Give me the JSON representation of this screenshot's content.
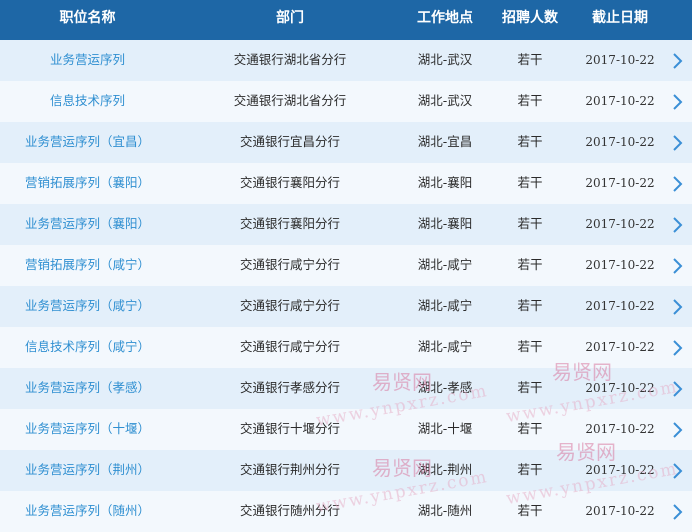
{
  "table": {
    "headers": {
      "title": "职位名称",
      "dept": "部门",
      "location": "工作地点",
      "count": "招聘人数",
      "deadline": "截止日期"
    },
    "rows": [
      {
        "title": "业务营运序列",
        "dept": "交通银行湖北省分行",
        "location": "湖北-武汉",
        "count": "若干",
        "deadline": "2017-10-22"
      },
      {
        "title": "信息技术序列",
        "dept": "交通银行湖北省分行",
        "location": "湖北-武汉",
        "count": "若干",
        "deadline": "2017-10-22"
      },
      {
        "title": "业务营运序列（宜昌）",
        "dept": "交通银行宜昌分行",
        "location": "湖北-宜昌",
        "count": "若干",
        "deadline": "2017-10-22"
      },
      {
        "title": "营销拓展序列（襄阳）",
        "dept": "交通银行襄阳分行",
        "location": "湖北-襄阳",
        "count": "若干",
        "deadline": "2017-10-22"
      },
      {
        "title": "业务营运序列（襄阳）",
        "dept": "交通银行襄阳分行",
        "location": "湖北-襄阳",
        "count": "若干",
        "deadline": "2017-10-22"
      },
      {
        "title": "营销拓展序列（咸宁）",
        "dept": "交通银行咸宁分行",
        "location": "湖北-咸宁",
        "count": "若干",
        "deadline": "2017-10-22"
      },
      {
        "title": "业务营运序列（咸宁）",
        "dept": "交通银行咸宁分行",
        "location": "湖北-咸宁",
        "count": "若干",
        "deadline": "2017-10-22"
      },
      {
        "title": "信息技术序列（咸宁）",
        "dept": "交通银行咸宁分行",
        "location": "湖北-咸宁",
        "count": "若干",
        "deadline": "2017-10-22"
      },
      {
        "title": "业务营运序列（孝感）",
        "dept": "交通银行孝感分行",
        "location": "湖北-孝感",
        "count": "若干",
        "deadline": "2017-10-22"
      },
      {
        "title": "业务营运序列（十堰）",
        "dept": "交通银行十堰分行",
        "location": "湖北-十堰",
        "count": "若干",
        "deadline": "2017-10-22"
      },
      {
        "title": "业务营运序列（荆州）",
        "dept": "交通银行荆州分行",
        "location": "湖北-荆州",
        "count": "若干",
        "deadline": "2017-10-22"
      },
      {
        "title": "业务营运序列（随州）",
        "dept": "交通银行随州分行",
        "location": "湖北-随州",
        "count": "若干",
        "deadline": "2017-10-22"
      }
    ]
  },
  "watermark": {
    "cn": "易贤网",
    "en": "www.ynpxrz.com"
  },
  "colors": {
    "header_bg": "#1e67a6",
    "row_even": "#e3effa",
    "row_odd": "#f3f8fd",
    "title_text": "#2f8fd1",
    "arrow": "#3a8fd6"
  },
  "icons": {
    "row_arrow": "chevron-right-icon"
  }
}
